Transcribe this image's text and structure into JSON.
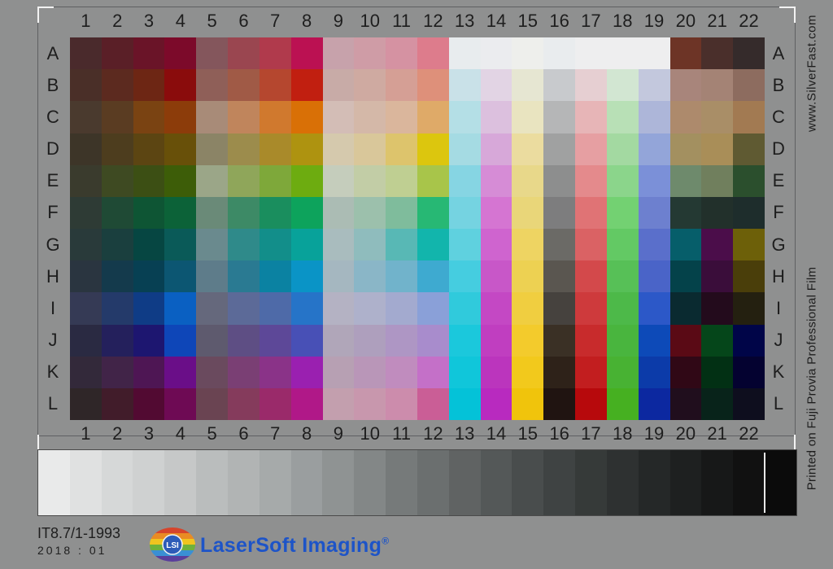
{
  "columns": [
    "1",
    "2",
    "3",
    "4",
    "5",
    "6",
    "7",
    "8",
    "9",
    "10",
    "11",
    "12",
    "13",
    "14",
    "15",
    "16",
    "17",
    "18",
    "19",
    "20",
    "21",
    "22"
  ],
  "rows": [
    "A",
    "B",
    "C",
    "D",
    "E",
    "F",
    "G",
    "H",
    "I",
    "J",
    "K",
    "L"
  ],
  "side_url": "www.SilverFast.com",
  "side_film": "Printed on Fuji Provia Professional Film",
  "standard": "IT8.7/1-1993",
  "batch": "2018 : 01",
  "logo_badge": "LSI",
  "brand": "LaserSoft Imaging",
  "brand_mark": "®",
  "patch_colors": [
    [
      "#4a2a2c",
      "#5a1f27",
      "#6a1428",
      "#7c0a2a",
      "#84565c",
      "#9a4650",
      "#b03a4c",
      "#bb1152",
      "#c7a2ab",
      "#cf9ca6",
      "#d592a2",
      "#dd7c8c",
      "#e8ecee",
      "#ebecef",
      "#eeefec",
      "#e9ecee",
      "#eeeeef",
      "#eeeeef",
      "#eeeeef",
      "#6d3426",
      "#4a2f2b",
      "#352b2b"
    ],
    [
      "#4a2f28",
      "#5c2a1f",
      "#6d2614",
      "#8a0c0c",
      "#8f5f58",
      "#a05a46",
      "#b5472f",
      "#c11f10",
      "#c8aba7",
      "#cfaaa1",
      "#d59f95",
      "#de907a",
      "#c9e1e8",
      "#e2d4e4",
      "#e6e6d2",
      "#c8cacd",
      "#e6cfd2",
      "#d2e6d2",
      "#c3c8dd",
      "#a8857b",
      "#a48375",
      "#8d6c5f"
    ],
    [
      "#4a3a2e",
      "#5a3c22",
      "#7a4312",
      "#8c3c0a",
      "#a88b78",
      "#c0855c",
      "#d0792e",
      "#d97006",
      "#d3bdb6",
      "#d4b8a8",
      "#dab69c",
      "#dfaa68",
      "#b4dfe6",
      "#dcc0de",
      "#e9e4c0",
      "#b5b6b7",
      "#e7b5b7",
      "#b8e0b6",
      "#adb6d9",
      "#ad8a6c",
      "#a98e67",
      "#a27a52"
    ],
    [
      "#3d3528",
      "#4d3d1e",
      "#5c4512",
      "#685009",
      "#8b8466",
      "#9c8c4c",
      "#a98a2a",
      "#ae9310",
      "#d5c9ad",
      "#d9c79a",
      "#ddc46c",
      "#dcc60e",
      "#a5dbe3",
      "#d7a8d9",
      "#ebdc9f",
      "#a0a1a1",
      "#e69fa2",
      "#a3d9a1",
      "#93a5d9",
      "#a39060",
      "#a98e58",
      "#5f5a32"
    ],
    [
      "#3a3b2d",
      "#3e4a22",
      "#3c4f14",
      "#3d5d08",
      "#9ba688",
      "#8fa65a",
      "#7ea83a",
      "#6dac10",
      "#c5cdbc",
      "#c2cda6",
      "#bfcf92",
      "#a8c54a",
      "#86d5e3",
      "#d68cd6",
      "#e8d88a",
      "#8d8e8e",
      "#e48a8c",
      "#8bd58b",
      "#7b90d8",
      "#6e8a6c",
      "#707f5d",
      "#2b4f2d"
    ],
    [
      "#2e3b35",
      "#1f4a35",
      "#0e5534",
      "#0c6238",
      "#6a8a78",
      "#3d8a66",
      "#1a8e5e",
      "#0da35c",
      "#abbcb4",
      "#9cc0ac",
      "#7fbc9c",
      "#27b874",
      "#75d3e1",
      "#d575d2",
      "#e9d679",
      "#7d7d7e",
      "#e07375",
      "#73d172",
      "#6d80cf",
      "#243933",
      "#22302b",
      "#1e2d2c"
    ],
    [
      "#293a3a",
      "#1a3f3e",
      "#064642",
      "#0a5a58",
      "#6a8a8e",
      "#2f8a8a",
      "#128e8a",
      "#08a29a",
      "#a9bcbe",
      "#8fbcbd",
      "#58b8b5",
      "#12b5ac",
      "#5fd1df",
      "#cf64cf",
      "#eed462",
      "#6b6a66",
      "#da6264",
      "#63c964",
      "#5a6fcb",
      "#065e6a",
      "#4b0d4a",
      "#6d6009"
    ],
    [
      "#2a3540",
      "#143a4c",
      "#074053",
      "#0c5672",
      "#5e7c8a",
      "#2a7a92",
      "#0b82a2",
      "#0a94c6",
      "#a5b7c0",
      "#8ab6c7",
      "#71b3cb",
      "#3eaad0",
      "#45cde0",
      "#c857c8",
      "#edd152",
      "#5a5650",
      "#d3494b",
      "#57c057",
      "#4a64c8",
      "#04424a",
      "#3a0d3a",
      "#4a3e0a"
    ],
    [
      "#353a55",
      "#243a6a",
      "#0f3c86",
      "#0a60c2",
      "#65687c",
      "#5c6a98",
      "#4e6aa8",
      "#2674c8",
      "#b4b2c3",
      "#aeb1cb",
      "#a3aacf",
      "#8aa0d8",
      "#30cadc",
      "#c448c4",
      "#f0ce40",
      "#46423e",
      "#ce3a3c",
      "#4db949",
      "#2c58c8",
      "#0a2a30",
      "#230b1c",
      "#242010"
    ],
    [
      "#2a2a42",
      "#24205c",
      "#1d1670",
      "#0e46b8",
      "#5e5a6e",
      "#5e4e84",
      "#5d4898",
      "#4850b6",
      "#b0a6b9",
      "#ae9fbd",
      "#ae96c4",
      "#a88ccc",
      "#1bc8dc",
      "#c03ec0",
      "#f3cb2c",
      "#3a3025",
      "#c82b2c",
      "#49b53e",
      "#0d4ab8",
      "#5a0a15",
      "#05461a",
      "#000548"
    ],
    [
      "#33293a",
      "#412448",
      "#4e1654",
      "#6a0e88",
      "#6a4a5e",
      "#7a3f74",
      "#8a3388",
      "#9a20b0",
      "#b7a0b3",
      "#b996b8",
      "#c08cbe",
      "#c470c8",
      "#10c6da",
      "#bb35bd",
      "#f2c91c",
      "#2e2219",
      "#c21e1f",
      "#48b233",
      "#0c3ba9",
      "#300816",
      "#023014",
      "#040230"
    ],
    [
      "#2f2628",
      "#411c2a",
      "#520a32",
      "#6e0a54",
      "#6a4452",
      "#853b5c",
      "#9a2a6a",
      "#b01888",
      "#c39fae",
      "#c897ad",
      "#cc8cac",
      "#ca5e96",
      "#04c2d8",
      "#b82abf",
      "#f0c40c",
      "#201411",
      "#b7090c",
      "#46b021",
      "#0c28a0",
      "#200e1d",
      "#08231a",
      "#0e0e1e"
    ]
  ],
  "ramp_colors": [
    "#e9eaea",
    "#e0e1e1",
    "#d6d8d8",
    "#cfd1d1",
    "#c6c8c8",
    "#babdbd",
    "#b1b4b4",
    "#a6aaaa",
    "#9a9e9f",
    "#8f9393",
    "#838787",
    "#767a7a",
    "#6b6f6f",
    "#606363",
    "#545858",
    "#494d4d",
    "#3f4343",
    "#363a39",
    "#2e3131",
    "#252828",
    "#1e2020",
    "#171818",
    "#111111",
    "#0b0b0b"
  ]
}
